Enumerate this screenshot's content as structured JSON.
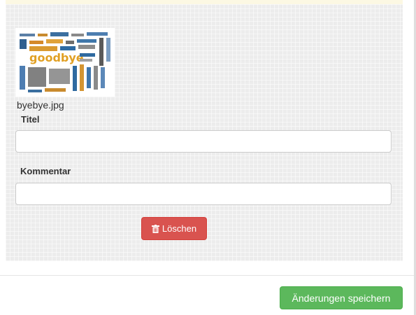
{
  "attachment": {
    "image_alt": "goodbye word cloud",
    "filename": "byebye.jpg"
  },
  "form": {
    "title_label": "Titel",
    "title_value": "",
    "comment_label": "Kommentar",
    "comment_value": ""
  },
  "actions": {
    "delete_label": "Löschen",
    "save_label": "Änderungen speichern"
  },
  "colors": {
    "delete": "#d9534f",
    "save": "#5cb85c",
    "alert": "#fcf8e3"
  },
  "icons": {
    "delete": "trash-icon"
  }
}
